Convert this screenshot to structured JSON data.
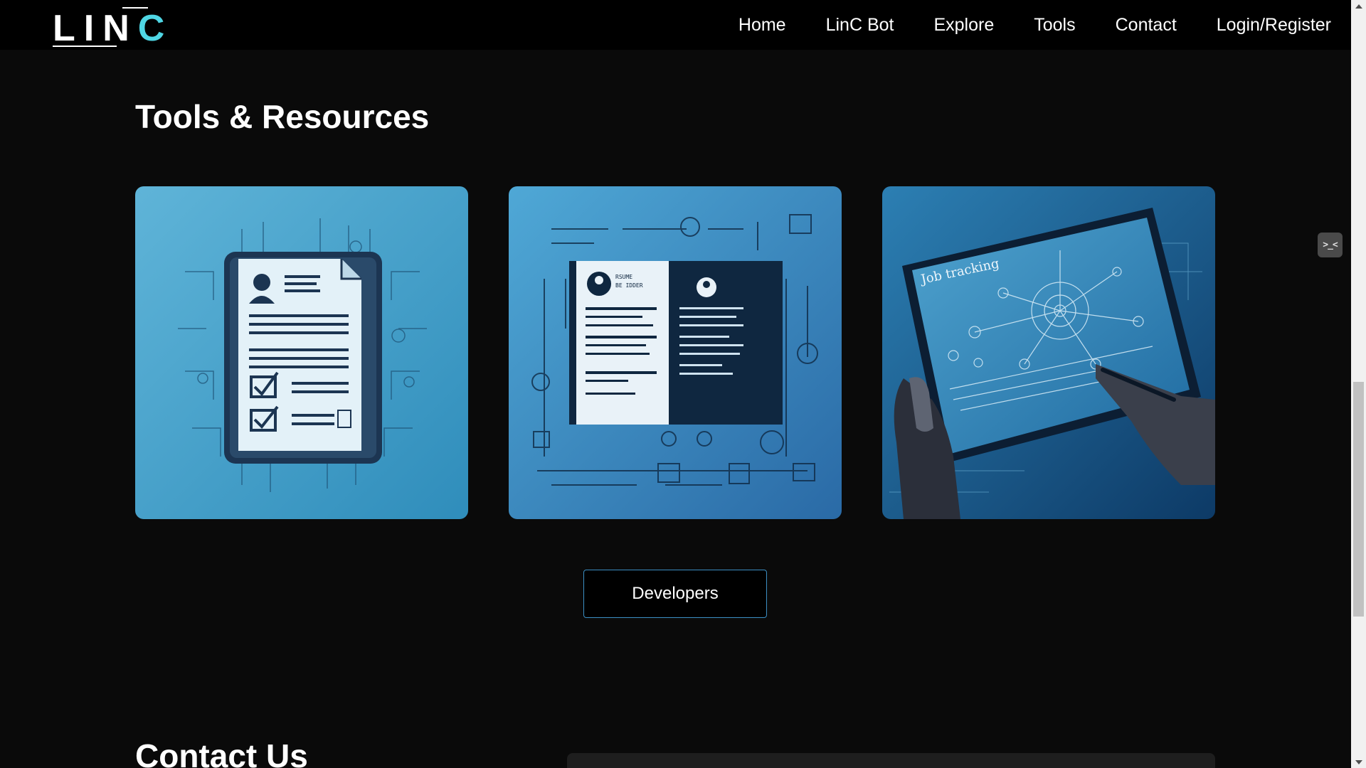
{
  "brand": {
    "logo_main": "LIN",
    "logo_accent": "C",
    "accent_color": "#4fd6e4"
  },
  "nav": {
    "items": [
      {
        "label": "Home"
      },
      {
        "label": "LinC Bot"
      },
      {
        "label": "Explore"
      },
      {
        "label": "Tools"
      },
      {
        "label": "Contact"
      },
      {
        "label": "Login/Register"
      }
    ]
  },
  "tools": {
    "title": "Tools & Resources",
    "cards": [
      {
        "image": "resume-checklist-illustration"
      },
      {
        "image": "resume-builder-illustration",
        "image_text": "RSUME BE IDDER"
      },
      {
        "image": "job-tracking-tablet-illustration",
        "image_text": "Job tracking"
      }
    ],
    "developers_button": "Developers"
  },
  "contact": {
    "title": "Contact Us"
  },
  "side_widget": {
    "icon": "code-toggle-icon",
    "glyph": ">_<"
  },
  "colors": {
    "background": "#0a0a0a",
    "navbar": "#000000",
    "button_border": "#3b8fc4"
  }
}
